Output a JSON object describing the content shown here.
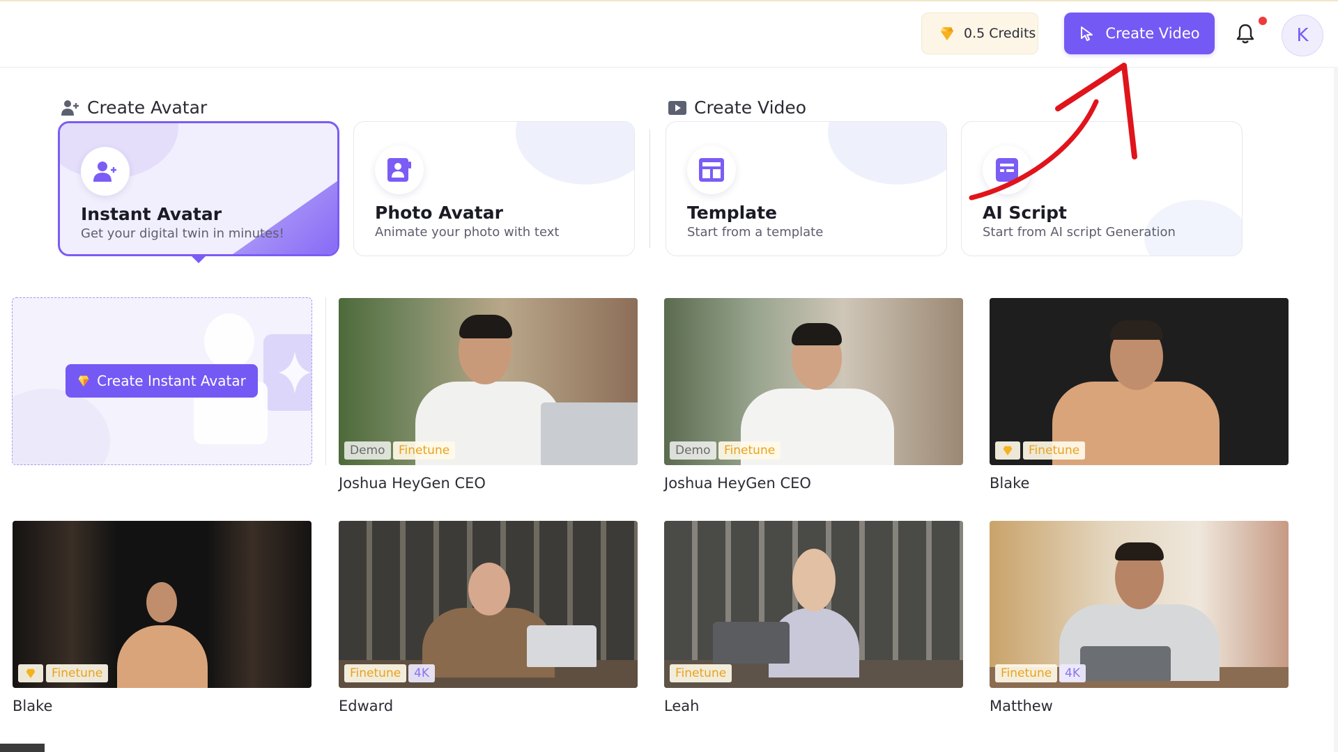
{
  "header": {
    "credits_label": "0.5 Credits",
    "create_video_label": "Create Video",
    "avatar_initial": "K"
  },
  "sections": {
    "create_avatar_title": "Create Avatar",
    "create_video_title": "Create Video"
  },
  "cards": [
    {
      "title": "Instant Avatar",
      "subtitle": "Get your digital twin in minutes!",
      "icon": "user-plus-icon",
      "selected": true
    },
    {
      "title": "Photo Avatar",
      "subtitle": "Animate your photo with text",
      "icon": "photo-avatar-icon",
      "selected": false
    },
    {
      "title": "Template",
      "subtitle": "Start from a template",
      "icon": "template-icon",
      "selected": false
    },
    {
      "title": "AI Script",
      "subtitle": "Start from AI script Generation",
      "icon": "script-icon",
      "selected": false
    }
  ],
  "create_instant_avatar_label": "Create Instant Avatar",
  "avatars": [
    {
      "name": "Joshua HeyGen CEO",
      "tags": [
        "Demo",
        "Finetune"
      ]
    },
    {
      "name": "Joshua HeyGen CEO",
      "tags": [
        "Demo",
        "Finetune"
      ]
    },
    {
      "name": "Blake",
      "tags": [
        "premium-gem",
        "Finetune"
      ]
    },
    {
      "name": "Blake",
      "tags": [
        "premium-gem",
        "Finetune"
      ]
    },
    {
      "name": "Edward",
      "tags": [
        "Finetune",
        "4K"
      ]
    },
    {
      "name": "Leah",
      "tags": [
        "Finetune"
      ]
    },
    {
      "name": "Matthew",
      "tags": [
        "Finetune",
        "4K"
      ]
    }
  ],
  "colors": {
    "accent": "#7559f4",
    "finetune": "#e9a21b",
    "fourk": "#8a74ee",
    "annotation": "#e0141b"
  }
}
